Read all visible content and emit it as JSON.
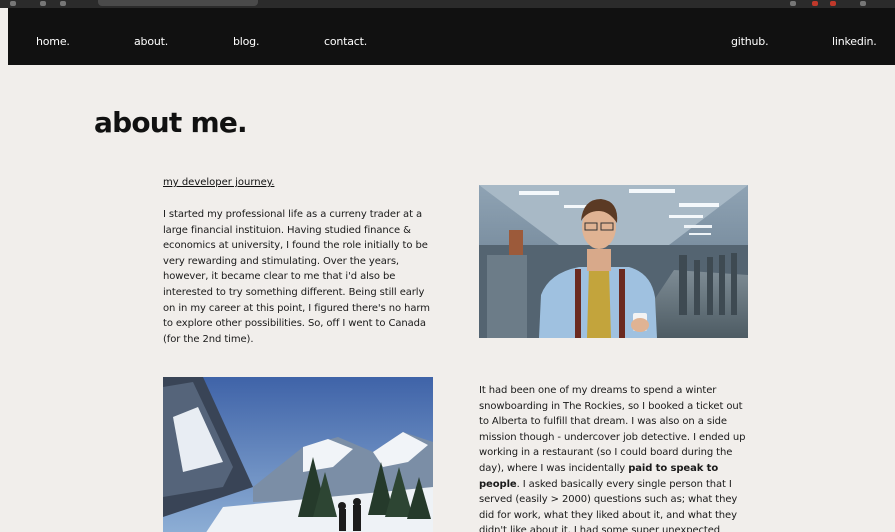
{
  "nav": {
    "home": "home.",
    "about": "about.",
    "blog": "blog.",
    "contact": "contact.",
    "github": "github.",
    "linkedin": "linkedin."
  },
  "page": {
    "title": "about me.",
    "journey_link": "my developer journey."
  },
  "content": {
    "paragraph_1": "I started my professional life as a curreny trader at a large financial instituion. Having studied finance & economics at university, I found the role initially to be very rewarding and stimulating. Over the years, however, it became clear to me that i'd also be interested to try something different. Being still early on in my career at this point, I figured there's no harm to explore other possibilities. So, off I went to Canada (for the 2nd time).",
    "paragraph_2_start": "It had been one of my dreams to spend a winter snowboarding in The Rockies, so I booked a ticket out to Alberta to fulfill that dream. I was also on a side mission though - undercover job detective. I ended up working in a restaurant (so I could board during the day), where I was incidentally ",
    "paragraph_2_bold": "paid to speak to people",
    "paragraph_2_end": ". I asked basically every single person that I served (easily > 2000) questions such as; what they did for work, what they liked about it, and what they didn't like about it. I had some super unexpected"
  },
  "colors": {
    "nav_bg": "#111111",
    "page_bg": "#f1eeeb",
    "text": "#1a1a1a"
  }
}
